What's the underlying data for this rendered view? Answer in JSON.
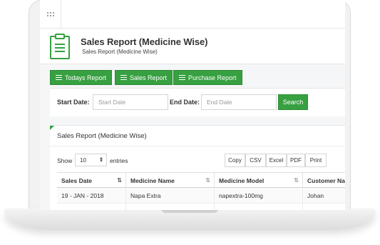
{
  "header": {
    "title": "Sales Report (Medicine Wise)",
    "subtitle": "Sales Report (Medicine Wise)"
  },
  "report_buttons": {
    "todays": "Todays Report",
    "sales": "Sales Report",
    "purchase": "Purchase Report"
  },
  "filter": {
    "start_label": "Start Date:",
    "start_placeholder": "Start Date",
    "end_label": "End Date:",
    "end_placeholder": "End Date",
    "search_label": "Search"
  },
  "table_panel": {
    "title": "Sales Report (Medicine Wise)",
    "show_label": "Show",
    "page_size": "10",
    "entries_label": "entries",
    "export_buttons": [
      "Copy",
      "CSV",
      "Excel",
      "PDF",
      "Print"
    ],
    "columns": [
      "Sales Date",
      "Medicine Name",
      "Medicine Model",
      "Customer Na"
    ],
    "rows": [
      [
        "19 - JAN - 2018",
        "Napa Extra",
        "napextra-100mg",
        "Johan"
      ]
    ]
  },
  "colors": {
    "accent": "#37a041"
  },
  "icons": [
    "grid-menu-icon",
    "clipboard-icon",
    "list-icon",
    "sort-icon"
  ]
}
